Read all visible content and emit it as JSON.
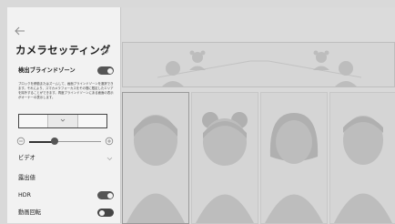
{
  "header": {
    "back_icon": "arrow-left-icon",
    "title": "カメラセッティング",
    "reset_icon": "reset-icon"
  },
  "blind_zone": {
    "label": "検出ブラインドゾーン",
    "enabled": true,
    "description": "ブロックを移動またはズームして、画面ブラインドゾーンを選択できます。それにより、スマカメラフォーカスをその間に限定したエリアを除外することができます。再度ブラインドゾーンにある面面の表示がオーナーの表示します。",
    "segments": [
      "left",
      "center",
      "right"
    ],
    "selected_segment": "center"
  },
  "zoom": {
    "out_icon": "zoom-out-icon",
    "in_icon": "zoom-in-icon",
    "level": 0.35
  },
  "video": {
    "label": "ビデオ",
    "chevron_icon": "chevron-down-icon"
  },
  "settings": [
    {
      "id": "exposure",
      "label": "露出値"
    },
    {
      "id": "hdr",
      "label": "HDR",
      "enabled": true
    },
    {
      "id": "rotation",
      "label": "動画回転",
      "enabled": false
    }
  ],
  "preview": {
    "wide_view_people": 2,
    "tiles": [
      "person-1",
      "person-2",
      "person-3",
      "person-4"
    ],
    "active_tile": 0
  },
  "colors": {
    "panel_bg": "#f2f2f2",
    "preview_bg": "#d9d9d9",
    "toggle_on": "#555555",
    "silhouette": "#bdbdbd"
  }
}
